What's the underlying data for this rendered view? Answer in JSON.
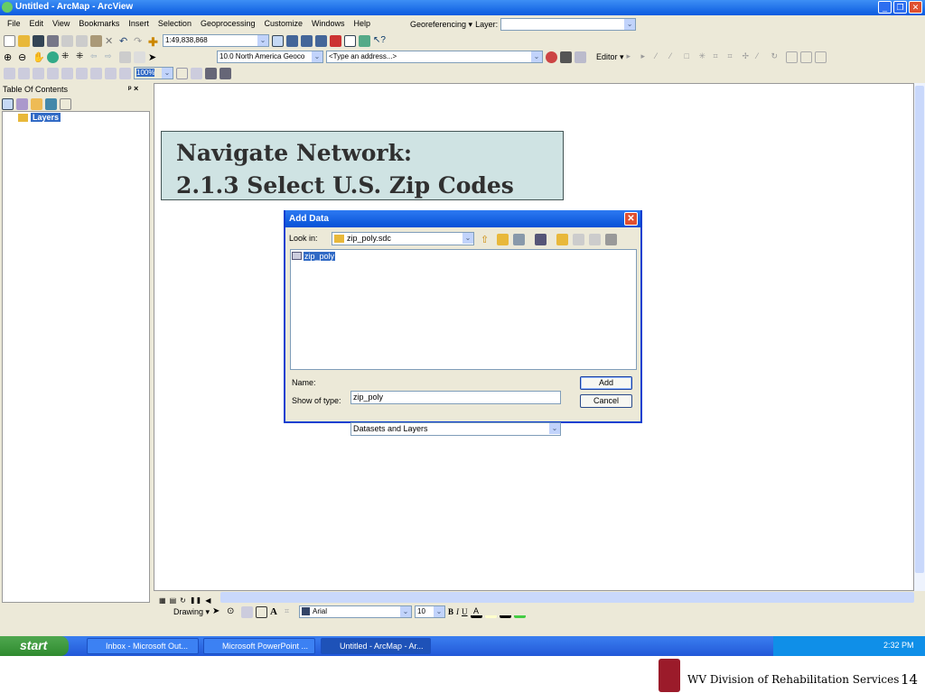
{
  "window": {
    "title": "Untitled - ArcMap - ArcView"
  },
  "menu": [
    "File",
    "Edit",
    "View",
    "Bookmarks",
    "Insert",
    "Selection",
    "Geoprocessing",
    "Customize",
    "Windows",
    "Help"
  ],
  "georef": {
    "label": "Georeferencing ▾",
    "layer_label": "Layer:"
  },
  "toolbar": {
    "scale": "1:49,838,868",
    "geocoder": "10.0 North America Geoco",
    "address_placeholder": "<Type an address...>",
    "zoom": "100%",
    "editor": "Editor ▾"
  },
  "toc": {
    "title": "Table Of Contents",
    "pin": "ᵖ ×",
    "root": "Layers"
  },
  "slide": {
    "line1": "Navigate Network:",
    "line2": "2.1.3 Select U.S. Zip Codes",
    "footer": "WV Division of Rehabilitation Services",
    "page": "14"
  },
  "dialog": {
    "title": "Add Data",
    "look_in_label": "Look in:",
    "look_in": "zip_poly.sdc",
    "items": [
      "zip_poly"
    ],
    "name_label": "Name:",
    "name": "zip_poly",
    "type_label": "Show of type:",
    "type": "Datasets and Layers",
    "add": "Add",
    "cancel": "Cancel"
  },
  "drawing": {
    "label": "Drawing ▾",
    "font": "Arial",
    "size": "10",
    "bold": "B",
    "italic": "I",
    "underline": "U"
  },
  "taskbar": {
    "start": "start",
    "tasks": [
      "Inbox - Microsoft Out...",
      "Microsoft PowerPoint ...",
      "Untitled - ArcMap - Ar..."
    ],
    "time": "2:32 PM"
  }
}
